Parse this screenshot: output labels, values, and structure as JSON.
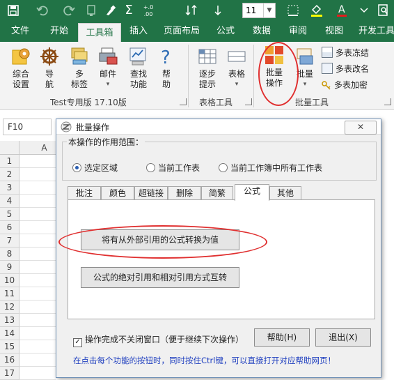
{
  "colors": {
    "excel_green": "#217346",
    "red_circle": "#e03030",
    "hint_blue": "#1f3fbf"
  },
  "qat": {
    "icons": [
      "save-icon",
      "undo-icon",
      "redo-icon",
      "format-painter-icon",
      "brush-icon",
      "sum-icon",
      "decimal-icon",
      "sort-icon",
      "font-size"
    ],
    "font_size": "11",
    "decimal_text": "+.0 .00",
    "sum_glyph": "Σ"
  },
  "ribbon_tabs": [
    "文件",
    "开始",
    "工具箱",
    "插入",
    "页面布局",
    "公式",
    "数据",
    "审阅",
    "视图",
    "开发工具"
  ],
  "active_tab": "工具箱",
  "ribbon": {
    "buttons": {
      "settings": "综合\n设置",
      "nav": "导\n航",
      "multi_label": "多\n标签",
      "mail": "邮件",
      "find": "查找\n功能",
      "help": "帮\n助",
      "step_hint": "逐步\n提示",
      "table": "表格",
      "batch_op": "批量\n操作",
      "batch": "批量"
    },
    "small_buttons": [
      "多表冻结",
      "多表改名",
      "多表加密"
    ],
    "groups": {
      "group1": "Test专用版 17.10版",
      "group2": "表格工具",
      "group3": "批量工具"
    }
  },
  "name_box": "F10",
  "grid": {
    "col_a": "A",
    "rows": [
      "1",
      "2",
      "3",
      "4",
      "5",
      "6",
      "7",
      "8",
      "9",
      "10",
      "11",
      "12",
      "13",
      "14",
      "15",
      "16",
      "17"
    ]
  },
  "dialog": {
    "title": "批量操作",
    "close_label": "✕",
    "scope_legend": "本操作的作用范围：",
    "radios": [
      "选定区域",
      "当前工作表",
      "当前工作簿中所有工作表"
    ],
    "selected_radio": 0,
    "tabs": [
      "批注",
      "颜色",
      "超链接",
      "删除",
      "简繁",
      "公式",
      "其他"
    ],
    "active_tab": 5,
    "btn_convert": "将有从外部引用的公式转换为值",
    "btn_absref": "公式的绝对引用和相对引用方式互转",
    "keep_open": "操作完成不关闭窗口（便于继续下次操作）",
    "keep_open_checked": true,
    "help_btn": "帮助(H)",
    "exit_btn": "退出(X)",
    "hint": "在点击每个功能的按钮时，同时按住Ctrl键，可以直接打开对应帮助网页！"
  }
}
